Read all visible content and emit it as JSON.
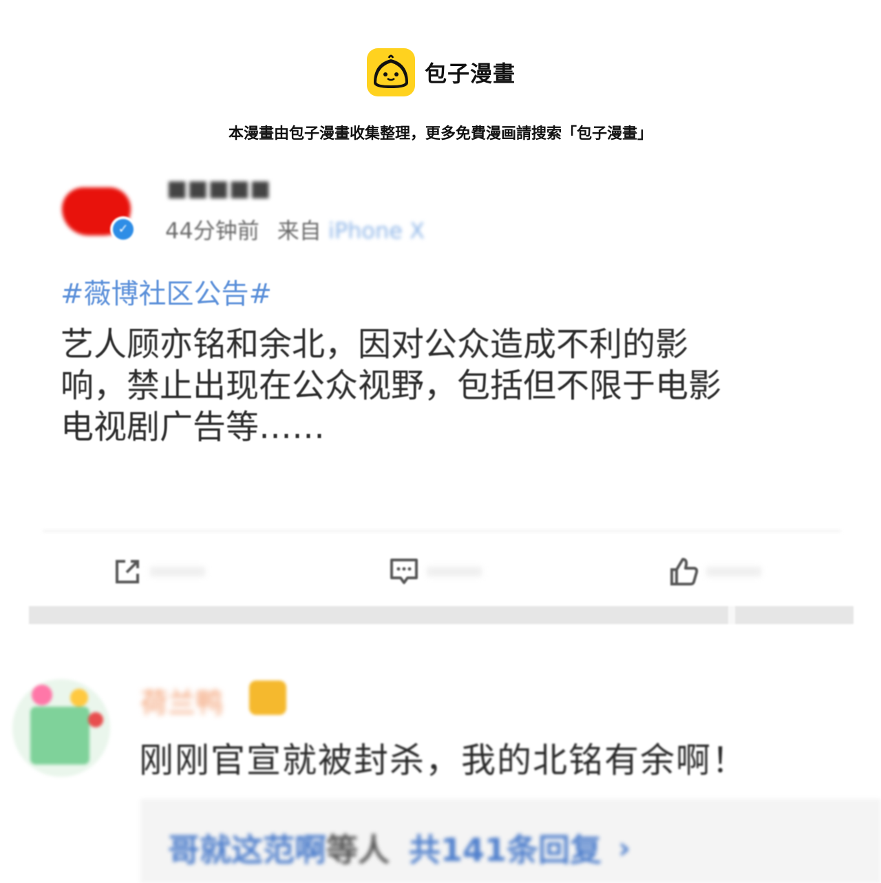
{
  "banner": {
    "brand_name": "包子漫畫",
    "notice": "本漫畫由包子漫畫收集整理，更多免費漫画請搜索「包子漫畫」",
    "logo_color": "#ffd21f"
  },
  "post": {
    "time": "44分钟前",
    "source_prefix": "来自",
    "device": "iPhone X",
    "hashtag": "#薇博社区公告#",
    "text": "艺人顾亦铭和余北，因对公众造成不利的影响，禁止出现在公众视野，包括但不限于电影电视剧广告等……",
    "actions": [
      {
        "icon": "share-icon"
      },
      {
        "icon": "comment-icon"
      },
      {
        "icon": "like-icon"
      }
    ]
  },
  "comment": {
    "username": "荷兰鸭",
    "badge_icon": "crown-badge-icon",
    "text": "刚刚官宣就被封杀，我的北铭有余啊！",
    "reply_names": "哥就这范啊",
    "reply_mid": "等人",
    "reply_total": "共141条回复",
    "reply_arrow": "›"
  },
  "colors": {
    "hashtag": "#5a8fd9",
    "link": "#4f7fcc",
    "username": "#f29a6b",
    "verified": "#2e8de6"
  }
}
